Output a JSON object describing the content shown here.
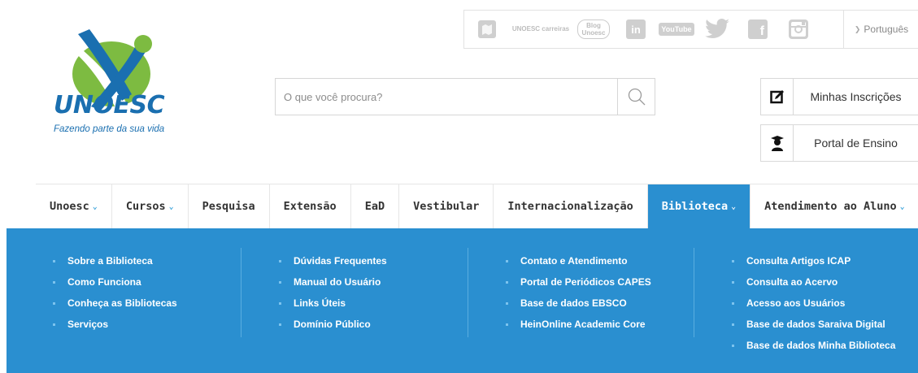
{
  "topbar": {
    "social": [
      {
        "icon": "unoesc-map-icon"
      },
      {
        "icon": "unoesc-carreiras-icon",
        "text": "UNOESC carreiras"
      },
      {
        "icon": "blog-unoesc-icon",
        "text": "Blog Unoesc"
      },
      {
        "icon": "linkedin-icon",
        "text": "in"
      },
      {
        "icon": "youtube-icon",
        "text": "YouTube"
      },
      {
        "icon": "twitter-icon"
      },
      {
        "icon": "facebook-icon",
        "text": "f"
      },
      {
        "icon": "instagram-icon"
      }
    ],
    "language": "Português"
  },
  "logo": {
    "name": "UNOESC",
    "tagline": "Fazendo parte da sua vida",
    "colors": {
      "green": "#7dbb41",
      "blue": "#1a6fb0"
    }
  },
  "search": {
    "placeholder": "O que você procura?"
  },
  "side_buttons": {
    "inscricoes": "Minhas Inscrições",
    "portal": "Portal de Ensino"
  },
  "nav": [
    {
      "label": "Unoesc",
      "dropdown": true
    },
    {
      "label": "Cursos",
      "dropdown": true
    },
    {
      "label": "Pesquisa",
      "dropdown": false
    },
    {
      "label": "Extensão",
      "dropdown": false
    },
    {
      "label": "EaD",
      "dropdown": false
    },
    {
      "label": "Vestibular",
      "dropdown": false
    },
    {
      "label": "Internacionalização",
      "dropdown": false
    },
    {
      "label": "Biblioteca",
      "dropdown": true,
      "active": true
    },
    {
      "label": "Atendimento ao Aluno",
      "dropdown": true
    }
  ],
  "dropdown": {
    "accent": "#2a8fd0",
    "columns": [
      [
        "Sobre a Biblioteca",
        "Como Funciona",
        "Conheça as Bibliotecas",
        "Serviços"
      ],
      [
        "Dúvidas Frequentes",
        "Manual do Usuário",
        "Links Úteis",
        "Domínio Público"
      ],
      [
        "Contato e Atendimento",
        "Portal de Periódicos CAPES",
        "Base de dados EBSCO",
        "HeinOnline Academic Core"
      ],
      [
        "Consulta Artigos ICAP",
        "Consulta ao Acervo",
        "Acesso aos Usuários",
        "Base de dados Saraiva Digital",
        "Base de dados Minha Biblioteca"
      ]
    ]
  }
}
